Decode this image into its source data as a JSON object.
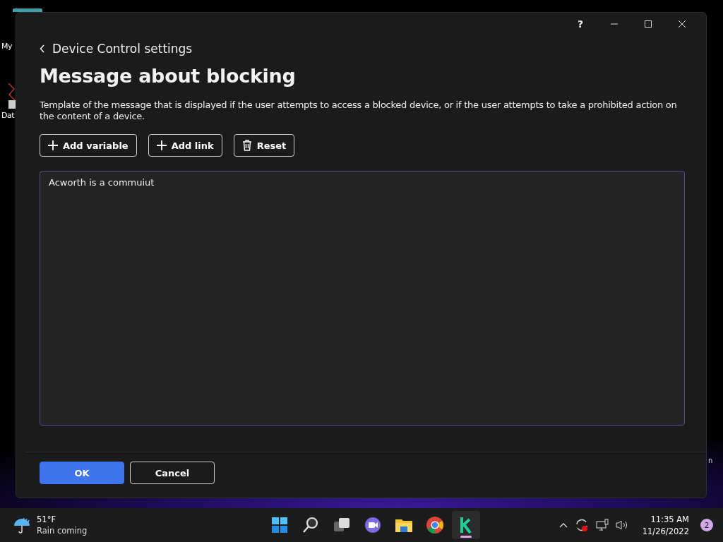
{
  "desktop": {
    "icons": [
      {
        "label": "My"
      },
      {
        "label": "Dat"
      }
    ],
    "fragment": "n"
  },
  "window": {
    "help": "?",
    "back_label": "Device Control settings",
    "heading": "Message about blocking",
    "description": "Template of the message that is displayed if the user attempts to access a blocked device, or if the user attempts to take a prohibited action on the content of a device.",
    "toolbar": [
      {
        "label": "Add variable",
        "kind": "plus"
      },
      {
        "label": "Add link",
        "kind": "plus"
      },
      {
        "label": "Reset",
        "kind": "trash"
      }
    ],
    "editor": {
      "value": "Acworth is a commuiut"
    },
    "buttons": [
      {
        "label": "OK",
        "kind": "primary"
      },
      {
        "label": "Cancel",
        "kind": "secondary"
      }
    ]
  },
  "taskbar": {
    "weather": {
      "temperature": "51°F",
      "forecast": "Rain coming"
    },
    "apps": [
      {
        "kind": "start",
        "selected": false
      },
      {
        "kind": "search",
        "selected": false
      },
      {
        "kind": "taskview",
        "selected": false
      },
      {
        "kind": "chat",
        "selected": false
      },
      {
        "kind": "files",
        "selected": false
      },
      {
        "kind": "browser",
        "selected": false
      },
      {
        "kind": "k-app",
        "selected": true
      }
    ],
    "clock": {
      "time": "11:35 AM",
      "date": "11/26/2022"
    },
    "notifications": "2"
  }
}
